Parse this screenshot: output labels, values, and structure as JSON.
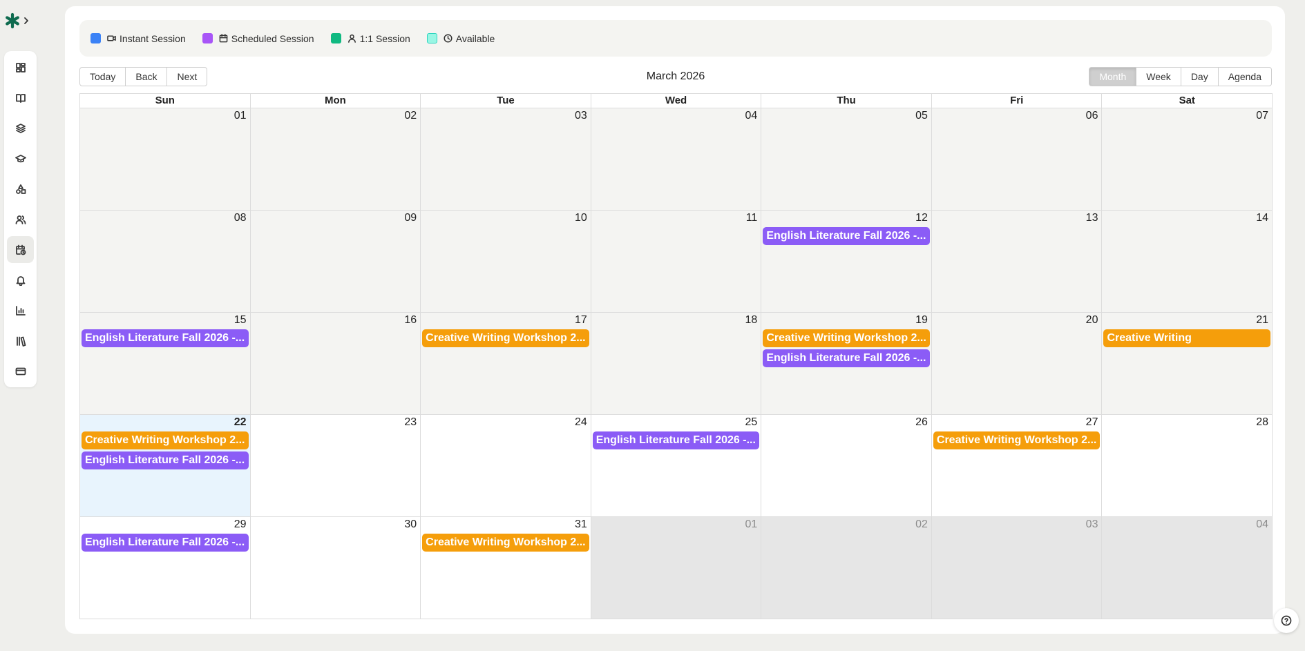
{
  "icons": {
    "brand": "asterisk-logo-icon",
    "brand_chevron": "chevron-right-icon",
    "rail": [
      "dashboard-icon",
      "book-icon",
      "layers-icon",
      "graduation-cap-icon",
      "shapes-icon",
      "users-icon",
      "calendar-clock-icon",
      "bell-icon",
      "bar-chart-icon",
      "library-icon",
      "credit-card-icon"
    ],
    "help": "help-circle-icon"
  },
  "colors": {
    "brand": "#0f6b4f",
    "instant": "#3b82f6",
    "scheduled": "#a855f7",
    "one_on_one": "#10b981",
    "available": "#99f6e4",
    "event_purple": "#8b5cf6",
    "event_orange": "#f59e0b"
  },
  "legend": [
    {
      "label": "Instant Session",
      "icon": "video-icon"
    },
    {
      "label": "Scheduled Session",
      "icon": "calendar-icon"
    },
    {
      "label": "1:1 Session",
      "icon": "user-icon"
    },
    {
      "label": "Available",
      "icon": "clock-icon"
    }
  ],
  "toolbar": {
    "today": "Today",
    "back": "Back",
    "next": "Next",
    "title": "March 2026",
    "views": [
      "Month",
      "Week",
      "Day",
      "Agenda"
    ],
    "active_view": "Month"
  },
  "calendar": {
    "weekdays": [
      "Sun",
      "Mon",
      "Tue",
      "Wed",
      "Thu",
      "Fri",
      "Sat"
    ],
    "weeks": [
      [
        {
          "date": "01",
          "state": "past",
          "events": []
        },
        {
          "date": "02",
          "state": "past",
          "events": []
        },
        {
          "date": "03",
          "state": "past",
          "events": []
        },
        {
          "date": "04",
          "state": "past",
          "events": []
        },
        {
          "date": "05",
          "state": "past",
          "events": []
        },
        {
          "date": "06",
          "state": "past",
          "events": []
        },
        {
          "date": "07",
          "state": "past",
          "events": []
        }
      ],
      [
        {
          "date": "08",
          "state": "past",
          "events": []
        },
        {
          "date": "09",
          "state": "past",
          "events": []
        },
        {
          "date": "10",
          "state": "past",
          "events": []
        },
        {
          "date": "11",
          "state": "past",
          "events": []
        },
        {
          "date": "12",
          "state": "past",
          "events": [
            {
              "title": "English Literature Fall 2026 -...",
              "color": "purple"
            }
          ]
        },
        {
          "date": "13",
          "state": "past",
          "events": []
        },
        {
          "date": "14",
          "state": "past",
          "events": []
        }
      ],
      [
        {
          "date": "15",
          "state": "past",
          "events": [
            {
              "title": "English Literature Fall 2026 -...",
              "color": "purple"
            }
          ]
        },
        {
          "date": "16",
          "state": "past",
          "events": []
        },
        {
          "date": "17",
          "state": "past",
          "events": [
            {
              "title": "Creative Writing Workshop 2...",
              "color": "orange"
            }
          ]
        },
        {
          "date": "18",
          "state": "past",
          "events": []
        },
        {
          "date": "19",
          "state": "past",
          "events": [
            {
              "title": "Creative Writing Workshop 2...",
              "color": "orange"
            },
            {
              "title": "English Literature Fall 2026 -...",
              "color": "purple"
            }
          ]
        },
        {
          "date": "20",
          "state": "past",
          "events": []
        },
        {
          "date": "21",
          "state": "past",
          "events": [
            {
              "title": "Creative Writing",
              "color": "orange"
            }
          ]
        }
      ],
      [
        {
          "date": "22",
          "state": "today",
          "events": [
            {
              "title": "Creative Writing Workshop 2...",
              "color": "orange"
            },
            {
              "title": "English Literature Fall 2026 -...",
              "color": "purple"
            }
          ]
        },
        {
          "date": "23",
          "state": "future",
          "events": []
        },
        {
          "date": "24",
          "state": "future",
          "events": []
        },
        {
          "date": "25",
          "state": "future",
          "events": [
            {
              "title": "English Literature Fall 2026 -...",
              "color": "purple"
            }
          ]
        },
        {
          "date": "26",
          "state": "future",
          "events": []
        },
        {
          "date": "27",
          "state": "future",
          "events": [
            {
              "title": "Creative Writing Workshop 2...",
              "color": "orange"
            }
          ]
        },
        {
          "date": "28",
          "state": "future",
          "events": []
        }
      ],
      [
        {
          "date": "29",
          "state": "future",
          "events": [
            {
              "title": "English Literature Fall 2026 -...",
              "color": "purple"
            }
          ]
        },
        {
          "date": "30",
          "state": "future",
          "events": []
        },
        {
          "date": "31",
          "state": "future",
          "events": [
            {
              "title": "Creative Writing Workshop 2...",
              "color": "orange"
            }
          ]
        },
        {
          "date": "01",
          "state": "off",
          "events": []
        },
        {
          "date": "02",
          "state": "off",
          "events": []
        },
        {
          "date": "03",
          "state": "off",
          "events": []
        },
        {
          "date": "04",
          "state": "off",
          "events": []
        }
      ]
    ]
  }
}
